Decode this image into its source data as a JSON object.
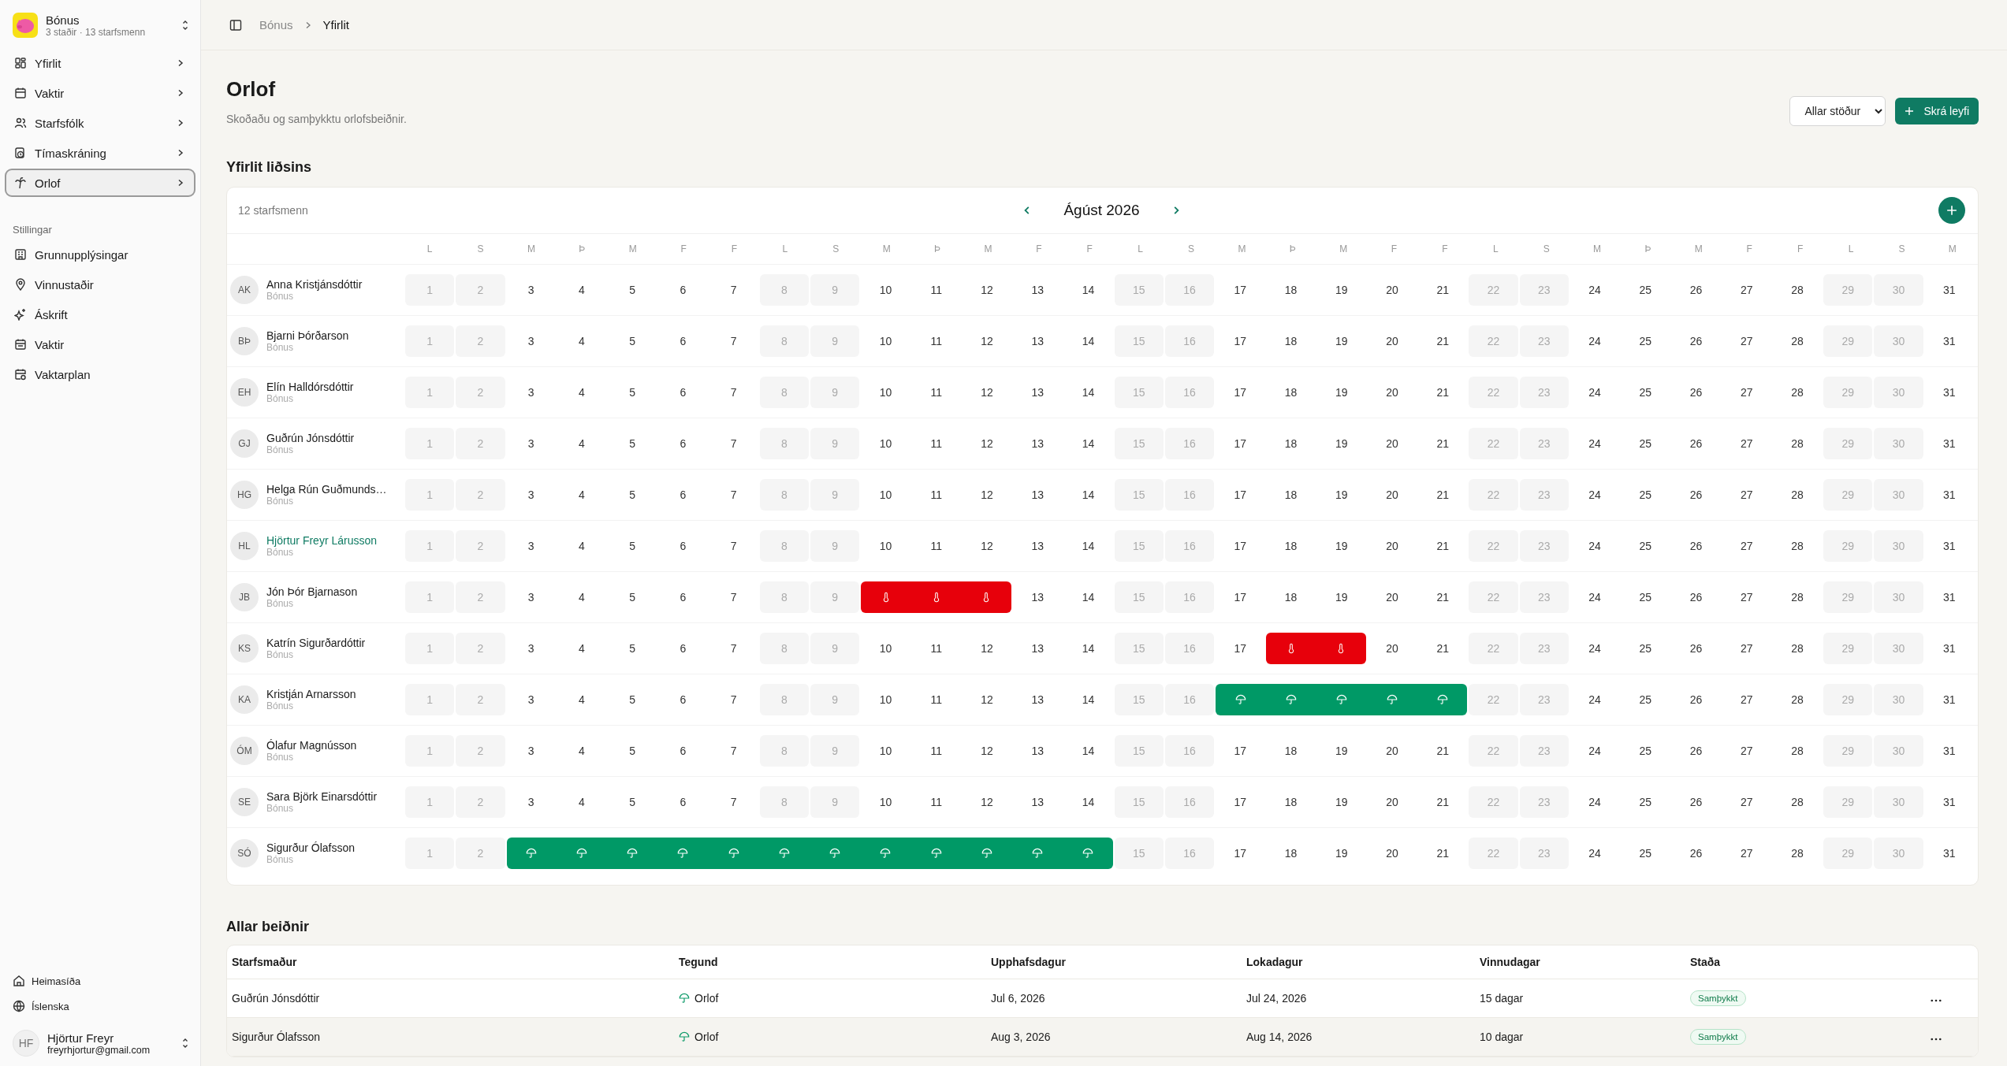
{
  "sidebar": {
    "team": {
      "name": "Bónus",
      "subtitle": "3 staðir · 13 starfsmenn"
    },
    "nav": [
      {
        "label": "Yfirlit",
        "kind": "grid",
        "selected": false
      },
      {
        "label": "Vaktir",
        "kind": "calendar",
        "selected": false
      },
      {
        "label": "Starfsfólk",
        "kind": "people",
        "selected": false
      },
      {
        "label": "Tímaskráning",
        "kind": "clock",
        "selected": false
      },
      {
        "label": "Orlof",
        "kind": "palm",
        "selected": true
      }
    ],
    "settings_title": "Stillingar",
    "settings": [
      {
        "label": "Grunnupplýsingar",
        "kind": "building"
      },
      {
        "label": "Vinnustaðir",
        "kind": "pin"
      },
      {
        "label": "Áskrift",
        "kind": "sparkle"
      },
      {
        "label": "Vaktir",
        "kind": "calendar"
      },
      {
        "label": "Vaktarplan",
        "kind": "plan"
      }
    ],
    "footer": [
      {
        "label": "Heimasíða",
        "kind": "home"
      },
      {
        "label": "Íslenska",
        "kind": "globe"
      }
    ],
    "user": {
      "initials": "HF",
      "name": "Hjörtur Freyr",
      "email": "freyrhjortur@gmail.com"
    }
  },
  "breadcrumb": [
    {
      "label": "Bónus",
      "current": false
    },
    {
      "label": "Yfirlit",
      "current": true
    }
  ],
  "page": {
    "title": "Orlof",
    "subtitle": "Skoðaðu og samþykktu orlofsbeiðnir.",
    "filter": "Allar stöður",
    "add_button": "Skrá leyfi"
  },
  "team_overview": {
    "title": "Yfirlit liðsins",
    "count": "12 starfsmenn",
    "month": "Ágúst 2026",
    "weekdays": [
      "L",
      "S",
      "M",
      "Þ",
      "M",
      "F",
      "F",
      "L",
      "S",
      "M",
      "Þ",
      "M",
      "F",
      "F",
      "L",
      "S",
      "M",
      "Þ",
      "M",
      "F",
      "F",
      "L",
      "S",
      "M",
      "Þ",
      "M",
      "F",
      "F",
      "L",
      "S",
      "M"
    ],
    "employees": [
      {
        "initials": "AK",
        "name": "Anna Kristjánsdóttir",
        "store": "Bónus",
        "highlighted": false,
        "days": [
          {
            "day": "1",
            "kind": "weekend"
          },
          {
            "day": "2",
            "kind": "weekend"
          },
          {
            "day": "3",
            "kind": "workday"
          },
          {
            "day": "4",
            "kind": "workday"
          },
          {
            "day": "5",
            "kind": "workday"
          },
          {
            "day": "6",
            "kind": "workday"
          },
          {
            "day": "7",
            "kind": "workday"
          },
          {
            "day": "8",
            "kind": "weekend"
          },
          {
            "day": "9",
            "kind": "weekend"
          },
          {
            "day": "10",
            "kind": "workday"
          },
          {
            "day": "11",
            "kind": "workday"
          },
          {
            "day": "12",
            "kind": "workday"
          },
          {
            "day": "13",
            "kind": "workday"
          },
          {
            "day": "14",
            "kind": "workday"
          },
          {
            "day": "15",
            "kind": "weekend"
          },
          {
            "day": "16",
            "kind": "weekend"
          },
          {
            "day": "17",
            "kind": "workday"
          },
          {
            "day": "18",
            "kind": "workday"
          },
          {
            "day": "19",
            "kind": "workday"
          },
          {
            "day": "20",
            "kind": "workday"
          },
          {
            "day": "21",
            "kind": "workday"
          },
          {
            "day": "22",
            "kind": "weekend"
          },
          {
            "day": "23",
            "kind": "weekend"
          },
          {
            "day": "24",
            "kind": "workday"
          },
          {
            "day": "25",
            "kind": "workday"
          },
          {
            "day": "26",
            "kind": "workday"
          },
          {
            "day": "27",
            "kind": "workday"
          },
          {
            "day": "28",
            "kind": "workday"
          },
          {
            "day": "29",
            "kind": "weekend"
          },
          {
            "day": "30",
            "kind": "weekend"
          },
          {
            "day": "31",
            "kind": "workday"
          }
        ]
      },
      {
        "initials": "BÞ",
        "name": "Bjarni Þórðarson",
        "store": "Bónus",
        "highlighted": false,
        "days": [
          {
            "day": "1",
            "kind": "weekend"
          },
          {
            "day": "2",
            "kind": "weekend"
          },
          {
            "day": "3",
            "kind": "workday"
          },
          {
            "day": "4",
            "kind": "workday"
          },
          {
            "day": "5",
            "kind": "workday"
          },
          {
            "day": "6",
            "kind": "workday"
          },
          {
            "day": "7",
            "kind": "workday"
          },
          {
            "day": "8",
            "kind": "weekend"
          },
          {
            "day": "9",
            "kind": "weekend"
          },
          {
            "day": "10",
            "kind": "workday"
          },
          {
            "day": "11",
            "kind": "workday"
          },
          {
            "day": "12",
            "kind": "workday"
          },
          {
            "day": "13",
            "kind": "workday"
          },
          {
            "day": "14",
            "kind": "workday"
          },
          {
            "day": "15",
            "kind": "weekend"
          },
          {
            "day": "16",
            "kind": "weekend"
          },
          {
            "day": "17",
            "kind": "workday"
          },
          {
            "day": "18",
            "kind": "workday"
          },
          {
            "day": "19",
            "kind": "workday"
          },
          {
            "day": "20",
            "kind": "workday"
          },
          {
            "day": "21",
            "kind": "workday"
          },
          {
            "day": "22",
            "kind": "weekend"
          },
          {
            "day": "23",
            "kind": "weekend"
          },
          {
            "day": "24",
            "kind": "workday"
          },
          {
            "day": "25",
            "kind": "workday"
          },
          {
            "day": "26",
            "kind": "workday"
          },
          {
            "day": "27",
            "kind": "workday"
          },
          {
            "day": "28",
            "kind": "workday"
          },
          {
            "day": "29",
            "kind": "weekend"
          },
          {
            "day": "30",
            "kind": "weekend"
          },
          {
            "day": "31",
            "kind": "workday"
          }
        ]
      },
      {
        "initials": "EH",
        "name": "Elín Halldórsdóttir",
        "store": "Bónus",
        "highlighted": false,
        "days": [
          {
            "day": "1",
            "kind": "weekend"
          },
          {
            "day": "2",
            "kind": "weekend"
          },
          {
            "day": "3",
            "kind": "workday"
          },
          {
            "day": "4",
            "kind": "workday"
          },
          {
            "day": "5",
            "kind": "workday"
          },
          {
            "day": "6",
            "kind": "workday"
          },
          {
            "day": "7",
            "kind": "workday"
          },
          {
            "day": "8",
            "kind": "weekend"
          },
          {
            "day": "9",
            "kind": "weekend"
          },
          {
            "day": "10",
            "kind": "workday"
          },
          {
            "day": "11",
            "kind": "workday"
          },
          {
            "day": "12",
            "kind": "workday"
          },
          {
            "day": "13",
            "kind": "workday"
          },
          {
            "day": "14",
            "kind": "workday"
          },
          {
            "day": "15",
            "kind": "weekend"
          },
          {
            "day": "16",
            "kind": "weekend"
          },
          {
            "day": "17",
            "kind": "workday"
          },
          {
            "day": "18",
            "kind": "workday"
          },
          {
            "day": "19",
            "kind": "workday"
          },
          {
            "day": "20",
            "kind": "workday"
          },
          {
            "day": "21",
            "kind": "workday"
          },
          {
            "day": "22",
            "kind": "weekend"
          },
          {
            "day": "23",
            "kind": "weekend"
          },
          {
            "day": "24",
            "kind": "workday"
          },
          {
            "day": "25",
            "kind": "workday"
          },
          {
            "day": "26",
            "kind": "workday"
          },
          {
            "day": "27",
            "kind": "workday"
          },
          {
            "day": "28",
            "kind": "workday"
          },
          {
            "day": "29",
            "kind": "weekend"
          },
          {
            "day": "30",
            "kind": "weekend"
          },
          {
            "day": "31",
            "kind": "workday"
          }
        ]
      },
      {
        "initials": "GJ",
        "name": "Guðrún Jónsdóttir",
        "store": "Bónus",
        "highlighted": false,
        "days": [
          {
            "day": "1",
            "kind": "weekend"
          },
          {
            "day": "2",
            "kind": "weekend"
          },
          {
            "day": "3",
            "kind": "workday"
          },
          {
            "day": "4",
            "kind": "workday"
          },
          {
            "day": "5",
            "kind": "workday"
          },
          {
            "day": "6",
            "kind": "workday"
          },
          {
            "day": "7",
            "kind": "workday"
          },
          {
            "day": "8",
            "kind": "weekend"
          },
          {
            "day": "9",
            "kind": "weekend"
          },
          {
            "day": "10",
            "kind": "workday"
          },
          {
            "day": "11",
            "kind": "workday"
          },
          {
            "day": "12",
            "kind": "workday"
          },
          {
            "day": "13",
            "kind": "workday"
          },
          {
            "day": "14",
            "kind": "workday"
          },
          {
            "day": "15",
            "kind": "weekend"
          },
          {
            "day": "16",
            "kind": "weekend"
          },
          {
            "day": "17",
            "kind": "workday"
          },
          {
            "day": "18",
            "kind": "workday"
          },
          {
            "day": "19",
            "kind": "workday"
          },
          {
            "day": "20",
            "kind": "workday"
          },
          {
            "day": "21",
            "kind": "workday"
          },
          {
            "day": "22",
            "kind": "weekend"
          },
          {
            "day": "23",
            "kind": "weekend"
          },
          {
            "day": "24",
            "kind": "workday"
          },
          {
            "day": "25",
            "kind": "workday"
          },
          {
            "day": "26",
            "kind": "workday"
          },
          {
            "day": "27",
            "kind": "workday"
          },
          {
            "day": "28",
            "kind": "workday"
          },
          {
            "day": "29",
            "kind": "weekend"
          },
          {
            "day": "30",
            "kind": "weekend"
          },
          {
            "day": "31",
            "kind": "workday"
          }
        ]
      },
      {
        "initials": "HG",
        "name": "Helga Rún Guðmunds…",
        "store": "Bónus",
        "highlighted": false,
        "days": [
          {
            "day": "1",
            "kind": "weekend"
          },
          {
            "day": "2",
            "kind": "weekend"
          },
          {
            "day": "3",
            "kind": "workday"
          },
          {
            "day": "4",
            "kind": "workday"
          },
          {
            "day": "5",
            "kind": "workday"
          },
          {
            "day": "6",
            "kind": "workday"
          },
          {
            "day": "7",
            "kind": "workday"
          },
          {
            "day": "8",
            "kind": "weekend"
          },
          {
            "day": "9",
            "kind": "weekend"
          },
          {
            "day": "10",
            "kind": "workday"
          },
          {
            "day": "11",
            "kind": "workday"
          },
          {
            "day": "12",
            "kind": "workday"
          },
          {
            "day": "13",
            "kind": "workday"
          },
          {
            "day": "14",
            "kind": "workday"
          },
          {
            "day": "15",
            "kind": "weekend"
          },
          {
            "day": "16",
            "kind": "weekend"
          },
          {
            "day": "17",
            "kind": "workday"
          },
          {
            "day": "18",
            "kind": "workday"
          },
          {
            "day": "19",
            "kind": "workday"
          },
          {
            "day": "20",
            "kind": "workday"
          },
          {
            "day": "21",
            "kind": "workday"
          },
          {
            "day": "22",
            "kind": "weekend"
          },
          {
            "day": "23",
            "kind": "weekend"
          },
          {
            "day": "24",
            "kind": "workday"
          },
          {
            "day": "25",
            "kind": "workday"
          },
          {
            "day": "26",
            "kind": "workday"
          },
          {
            "day": "27",
            "kind": "workday"
          },
          {
            "day": "28",
            "kind": "workday"
          },
          {
            "day": "29",
            "kind": "weekend"
          },
          {
            "day": "30",
            "kind": "weekend"
          },
          {
            "day": "31",
            "kind": "workday"
          }
        ]
      },
      {
        "initials": "HL",
        "name": "Hjörtur Freyr Lárusson",
        "store": "Bónus",
        "highlighted": true,
        "days": [
          {
            "day": "1",
            "kind": "weekend"
          },
          {
            "day": "2",
            "kind": "weekend"
          },
          {
            "day": "3",
            "kind": "workday"
          },
          {
            "day": "4",
            "kind": "workday"
          },
          {
            "day": "5",
            "kind": "workday"
          },
          {
            "day": "6",
            "kind": "workday"
          },
          {
            "day": "7",
            "kind": "workday"
          },
          {
            "day": "8",
            "kind": "weekend"
          },
          {
            "day": "9",
            "kind": "weekend"
          },
          {
            "day": "10",
            "kind": "workday"
          },
          {
            "day": "11",
            "kind": "workday"
          },
          {
            "day": "12",
            "kind": "workday"
          },
          {
            "day": "13",
            "kind": "workday"
          },
          {
            "day": "14",
            "kind": "workday"
          },
          {
            "day": "15",
            "kind": "weekend"
          },
          {
            "day": "16",
            "kind": "weekend"
          },
          {
            "day": "17",
            "kind": "workday"
          },
          {
            "day": "18",
            "kind": "workday"
          },
          {
            "day": "19",
            "kind": "workday"
          },
          {
            "day": "20",
            "kind": "workday"
          },
          {
            "day": "21",
            "kind": "workday"
          },
          {
            "day": "22",
            "kind": "weekend"
          },
          {
            "day": "23",
            "kind": "weekend"
          },
          {
            "day": "24",
            "kind": "workday"
          },
          {
            "day": "25",
            "kind": "workday"
          },
          {
            "day": "26",
            "kind": "workday"
          },
          {
            "day": "27",
            "kind": "workday"
          },
          {
            "day": "28",
            "kind": "workday"
          },
          {
            "day": "29",
            "kind": "weekend"
          },
          {
            "day": "30",
            "kind": "weekend"
          },
          {
            "day": "31",
            "kind": "workday"
          }
        ]
      },
      {
        "initials": "JB",
        "name": "Jón Þór Bjarnason",
        "store": "Bónus",
        "highlighted": false,
        "days": [
          {
            "day": "1",
            "kind": "weekend"
          },
          {
            "day": "2",
            "kind": "weekend"
          },
          {
            "day": "3",
            "kind": "workday"
          },
          {
            "day": "4",
            "kind": "workday"
          },
          {
            "day": "5",
            "kind": "workday"
          },
          {
            "day": "6",
            "kind": "workday"
          },
          {
            "day": "7",
            "kind": "workday"
          },
          {
            "day": "8",
            "kind": "weekend"
          },
          {
            "day": "9",
            "kind": "weekend"
          },
          {
            "kind": "sick"
          },
          {
            "kind": "sick"
          },
          {
            "kind": "sick"
          },
          {
            "day": "13",
            "kind": "workday"
          },
          {
            "day": "14",
            "kind": "workday"
          },
          {
            "day": "15",
            "kind": "weekend"
          },
          {
            "day": "16",
            "kind": "weekend"
          },
          {
            "day": "17",
            "kind": "workday"
          },
          {
            "day": "18",
            "kind": "workday"
          },
          {
            "day": "19",
            "kind": "workday"
          },
          {
            "day": "20",
            "kind": "workday"
          },
          {
            "day": "21",
            "kind": "workday"
          },
          {
            "day": "22",
            "kind": "weekend"
          },
          {
            "day": "23",
            "kind": "weekend"
          },
          {
            "day": "24",
            "kind": "workday"
          },
          {
            "day": "25",
            "kind": "workday"
          },
          {
            "day": "26",
            "kind": "workday"
          },
          {
            "day": "27",
            "kind": "workday"
          },
          {
            "day": "28",
            "kind": "workday"
          },
          {
            "day": "29",
            "kind": "weekend"
          },
          {
            "day": "30",
            "kind": "weekend"
          },
          {
            "day": "31",
            "kind": "workday"
          }
        ]
      },
      {
        "initials": "KS",
        "name": "Katrín Sigurðardóttir",
        "store": "Bónus",
        "highlighted": false,
        "days": [
          {
            "day": "1",
            "kind": "weekend"
          },
          {
            "day": "2",
            "kind": "weekend"
          },
          {
            "day": "3",
            "kind": "workday"
          },
          {
            "day": "4",
            "kind": "workday"
          },
          {
            "day": "5",
            "kind": "workday"
          },
          {
            "day": "6",
            "kind": "workday"
          },
          {
            "day": "7",
            "kind": "workday"
          },
          {
            "day": "8",
            "kind": "weekend"
          },
          {
            "day": "9",
            "kind": "weekend"
          },
          {
            "day": "10",
            "kind": "workday"
          },
          {
            "day": "11",
            "kind": "workday"
          },
          {
            "day": "12",
            "kind": "workday"
          },
          {
            "day": "13",
            "kind": "workday"
          },
          {
            "day": "14",
            "kind": "workday"
          },
          {
            "day": "15",
            "kind": "weekend"
          },
          {
            "day": "16",
            "kind": "weekend"
          },
          {
            "day": "17",
            "kind": "workday"
          },
          {
            "kind": "sick"
          },
          {
            "kind": "sick"
          },
          {
            "day": "20",
            "kind": "workday"
          },
          {
            "day": "21",
            "kind": "workday"
          },
          {
            "day": "22",
            "kind": "weekend"
          },
          {
            "day": "23",
            "kind": "weekend"
          },
          {
            "day": "24",
            "kind": "workday"
          },
          {
            "day": "25",
            "kind": "workday"
          },
          {
            "day": "26",
            "kind": "workday"
          },
          {
            "day": "27",
            "kind": "workday"
          },
          {
            "day": "28",
            "kind": "workday"
          },
          {
            "day": "29",
            "kind": "weekend"
          },
          {
            "day": "30",
            "kind": "weekend"
          },
          {
            "day": "31",
            "kind": "workday"
          }
        ]
      },
      {
        "initials": "KA",
        "name": "Kristján Arnarsson",
        "store": "Bónus",
        "highlighted": false,
        "days": [
          {
            "day": "1",
            "kind": "weekend"
          },
          {
            "day": "2",
            "kind": "weekend"
          },
          {
            "day": "3",
            "kind": "workday"
          },
          {
            "day": "4",
            "kind": "workday"
          },
          {
            "day": "5",
            "kind": "workday"
          },
          {
            "day": "6",
            "kind": "workday"
          },
          {
            "day": "7",
            "kind": "workday"
          },
          {
            "day": "8",
            "kind": "weekend"
          },
          {
            "day": "9",
            "kind": "weekend"
          },
          {
            "day": "10",
            "kind": "workday"
          },
          {
            "day": "11",
            "kind": "workday"
          },
          {
            "day": "12",
            "kind": "workday"
          },
          {
            "day": "13",
            "kind": "workday"
          },
          {
            "day": "14",
            "kind": "workday"
          },
          {
            "day": "15",
            "kind": "weekend"
          },
          {
            "day": "16",
            "kind": "weekend"
          },
          {
            "kind": "vacation"
          },
          {
            "kind": "vacation"
          },
          {
            "kind": "vacation"
          },
          {
            "kind": "vacation"
          },
          {
            "kind": "vacation"
          },
          {
            "day": "22",
            "kind": "weekend"
          },
          {
            "day": "23",
            "kind": "weekend"
          },
          {
            "day": "24",
            "kind": "workday"
          },
          {
            "day": "25",
            "kind": "workday"
          },
          {
            "day": "26",
            "kind": "workday"
          },
          {
            "day": "27",
            "kind": "workday"
          },
          {
            "day": "28",
            "kind": "workday"
          },
          {
            "day": "29",
            "kind": "weekend"
          },
          {
            "day": "30",
            "kind": "weekend"
          },
          {
            "day": "31",
            "kind": "workday"
          }
        ]
      },
      {
        "initials": "ÓM",
        "name": "Ólafur Magnússon",
        "store": "Bónus",
        "highlighted": false,
        "days": [
          {
            "day": "1",
            "kind": "weekend"
          },
          {
            "day": "2",
            "kind": "weekend"
          },
          {
            "day": "3",
            "kind": "workday"
          },
          {
            "day": "4",
            "kind": "workday"
          },
          {
            "day": "5",
            "kind": "workday"
          },
          {
            "day": "6",
            "kind": "workday"
          },
          {
            "day": "7",
            "kind": "workday"
          },
          {
            "day": "8",
            "kind": "weekend"
          },
          {
            "day": "9",
            "kind": "weekend"
          },
          {
            "day": "10",
            "kind": "workday"
          },
          {
            "day": "11",
            "kind": "workday"
          },
          {
            "day": "12",
            "kind": "workday"
          },
          {
            "day": "13",
            "kind": "workday"
          },
          {
            "day": "14",
            "kind": "workday"
          },
          {
            "day": "15",
            "kind": "weekend"
          },
          {
            "day": "16",
            "kind": "weekend"
          },
          {
            "day": "17",
            "kind": "workday"
          },
          {
            "day": "18",
            "kind": "workday"
          },
          {
            "day": "19",
            "kind": "workday"
          },
          {
            "day": "20",
            "kind": "workday"
          },
          {
            "day": "21",
            "kind": "workday"
          },
          {
            "day": "22",
            "kind": "weekend"
          },
          {
            "day": "23",
            "kind": "weekend"
          },
          {
            "day": "24",
            "kind": "workday"
          },
          {
            "day": "25",
            "kind": "workday"
          },
          {
            "day": "26",
            "kind": "workday"
          },
          {
            "day": "27",
            "kind": "workday"
          },
          {
            "day": "28",
            "kind": "workday"
          },
          {
            "day": "29",
            "kind": "weekend"
          },
          {
            "day": "30",
            "kind": "weekend"
          },
          {
            "day": "31",
            "kind": "workday"
          }
        ]
      },
      {
        "initials": "SE",
        "name": "Sara Björk Einarsdóttir",
        "store": "Bónus",
        "highlighted": false,
        "days": [
          {
            "day": "1",
            "kind": "weekend"
          },
          {
            "day": "2",
            "kind": "weekend"
          },
          {
            "day": "3",
            "kind": "workday"
          },
          {
            "day": "4",
            "kind": "workday"
          },
          {
            "day": "5",
            "kind": "workday"
          },
          {
            "day": "6",
            "kind": "workday"
          },
          {
            "day": "7",
            "kind": "workday"
          },
          {
            "day": "8",
            "kind": "weekend"
          },
          {
            "day": "9",
            "kind": "weekend"
          },
          {
            "day": "10",
            "kind": "workday"
          },
          {
            "day": "11",
            "kind": "workday"
          },
          {
            "day": "12",
            "kind": "workday"
          },
          {
            "day": "13",
            "kind": "workday"
          },
          {
            "day": "14",
            "kind": "workday"
          },
          {
            "day": "15",
            "kind": "weekend"
          },
          {
            "day": "16",
            "kind": "weekend"
          },
          {
            "day": "17",
            "kind": "workday"
          },
          {
            "day": "18",
            "kind": "workday"
          },
          {
            "day": "19",
            "kind": "workday"
          },
          {
            "day": "20",
            "kind": "workday"
          },
          {
            "day": "21",
            "kind": "workday"
          },
          {
            "day": "22",
            "kind": "weekend"
          },
          {
            "day": "23",
            "kind": "weekend"
          },
          {
            "day": "24",
            "kind": "workday"
          },
          {
            "day": "25",
            "kind": "workday"
          },
          {
            "day": "26",
            "kind": "workday"
          },
          {
            "day": "27",
            "kind": "workday"
          },
          {
            "day": "28",
            "kind": "workday"
          },
          {
            "day": "29",
            "kind": "weekend"
          },
          {
            "day": "30",
            "kind": "weekend"
          },
          {
            "day": "31",
            "kind": "workday"
          }
        ]
      },
      {
        "initials": "SÓ",
        "name": "Sigurður Ólafsson",
        "store": "Bónus",
        "highlighted": false,
        "days": [
          {
            "day": "1",
            "kind": "weekend"
          },
          {
            "day": "2",
            "kind": "weekend"
          },
          {
            "kind": "vacation"
          },
          {
            "kind": "vacation"
          },
          {
            "kind": "vacation"
          },
          {
            "kind": "vacation"
          },
          {
            "kind": "vacation"
          },
          {
            "kind": "vacation"
          },
          {
            "kind": "vacation"
          },
          {
            "kind": "vacation"
          },
          {
            "kind": "vacation"
          },
          {
            "kind": "vacation"
          },
          {
            "kind": "vacation"
          },
          {
            "kind": "vacation"
          },
          {
            "day": "15",
            "kind": "weekend"
          },
          {
            "day": "16",
            "kind": "weekend"
          },
          {
            "day": "17",
            "kind": "workday"
          },
          {
            "day": "18",
            "kind": "workday"
          },
          {
            "day": "19",
            "kind": "workday"
          },
          {
            "day": "20",
            "kind": "workday"
          },
          {
            "day": "21",
            "kind": "workday"
          },
          {
            "day": "22",
            "kind": "weekend"
          },
          {
            "day": "23",
            "kind": "weekend"
          },
          {
            "day": "24",
            "kind": "workday"
          },
          {
            "day": "25",
            "kind": "workday"
          },
          {
            "day": "26",
            "kind": "workday"
          },
          {
            "day": "27",
            "kind": "workday"
          },
          {
            "day": "28",
            "kind": "workday"
          },
          {
            "day": "29",
            "kind": "weekend"
          },
          {
            "day": "30",
            "kind": "weekend"
          },
          {
            "day": "31",
            "kind": "workday"
          }
        ]
      }
    ]
  },
  "requests": {
    "title": "Allar beiðnir",
    "columns": [
      "Starfsmaður",
      "Tegund",
      "Upphafsdagur",
      "Lokadagur",
      "Vinnudagar",
      "Staða"
    ],
    "rows": [
      {
        "employee": "Guðrún Jónsdóttir",
        "type": "Orlof",
        "start": "Jul 6, 2026",
        "end": "Jul 24, 2026",
        "workdays": "15 dagar",
        "status": "Samþykkt",
        "hovered": false
      },
      {
        "employee": "Sigurður Ólafsson",
        "type": "Orlof",
        "start": "Aug 3, 2026",
        "end": "Aug 14, 2026",
        "workdays": "10 dagar",
        "status": "Samþykkt",
        "hovered": true
      }
    ]
  }
}
